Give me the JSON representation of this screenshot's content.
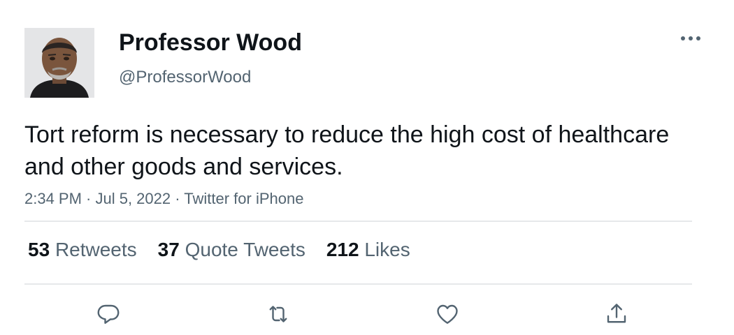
{
  "author": {
    "display_name": "Professor Wood",
    "handle": "@ProfessorWood",
    "avatar": "profile-photo"
  },
  "tweet": {
    "text": "Tort reform is necessary to reduce the high cost of healthcare and other goods and services.",
    "meta": "2:34 PM · Jul 5, 2022 · Twitter for iPhone"
  },
  "stats": {
    "retweets_count": "53",
    "retweets_label": "Retweets",
    "quotes_count": "37",
    "quotes_label": "Quote Tweets",
    "likes_count": "212",
    "likes_label": "Likes"
  },
  "icons": {
    "more": "more-icon",
    "reply": "reply-icon",
    "retweet": "retweet-icon",
    "like": "like-icon",
    "share": "share-icon"
  },
  "colors": {
    "text_primary": "#0f1419",
    "text_secondary": "#536471",
    "divider": "#e6e8ea"
  }
}
